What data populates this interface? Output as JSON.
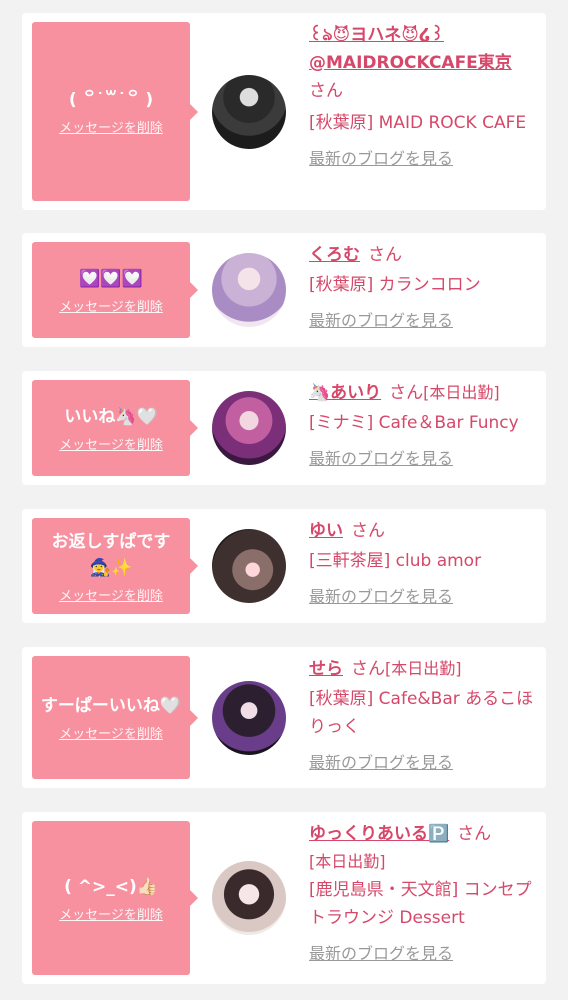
{
  "delete_label": "メッセージを削除",
  "honorific": "さん",
  "blog_label": "最新のブログを見る",
  "colors": {
    "background": "#f2f2f2",
    "card": "#ffffff",
    "bubble": "#f7909f",
    "accent_text": "#d6486a",
    "link_gray": "#999999"
  },
  "entries": [
    {
      "message": "( ꒪˙꒳˙꒪ )",
      "name": "꒰ঌ😈ヨハネ😈໒꒱ @MAIDROCKCAFE東京",
      "status": "",
      "shop": "[秋葉原] MAID ROCK CAFE"
    },
    {
      "message": "💟💟💟",
      "name": "くろむ",
      "status": "",
      "shop": "[秋葉原] カランコロン"
    },
    {
      "message": "いいね🦄🤍",
      "name": "🦄あいり",
      "status": "[本日出勤]",
      "shop": "[ミナミ] Cafe＆Bar Funcy"
    },
    {
      "message": "お返しすぱです🧙‍♀️✨",
      "name": "ゆい",
      "status": "",
      "shop": "[三軒茶屋] club amor"
    },
    {
      "message": "すーぱーいいね🤍",
      "name": "せら",
      "status": "[本日出勤]",
      "shop": "[秋葉原] Cafe&Bar あるこほりっく"
    },
    {
      "message": "( ^>_<)👍🏻",
      "name": "ゆっくりあいる🅿️",
      "status": "[本日出勤]",
      "shop": "[鹿児島県・天文館] コンセプトラウンジ Dessert"
    }
  ]
}
